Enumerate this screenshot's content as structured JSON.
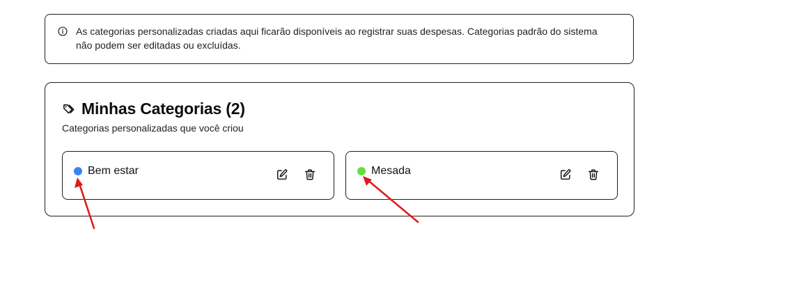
{
  "info": {
    "icon": "info-circle-icon",
    "text": "As categorias personalizadas criadas aqui ficarão disponíveis ao registrar suas despesas. Categorias padrão do sistema não podem ser editadas ou excluídas."
  },
  "categories_card": {
    "icon": "tag-icon",
    "title": "Minhas Categorias (2)",
    "subtitle": "Categorias personalizadas que você criou",
    "items": [
      {
        "name": "Bem estar",
        "color": "#3b82f6",
        "edit_icon": "edit-icon",
        "delete_icon": "trash-icon"
      },
      {
        "name": "Mesada",
        "color": "#5fe03a",
        "edit_icon": "edit-icon",
        "delete_icon": "trash-icon"
      }
    ]
  },
  "annotations": {
    "arrow_color": "#e01b1b"
  }
}
